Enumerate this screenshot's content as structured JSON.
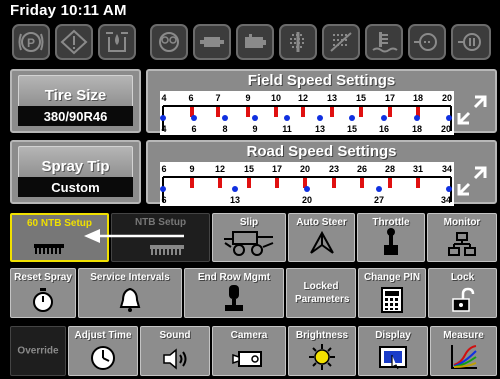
{
  "header": {
    "clock": "Friday 10:11 AM"
  },
  "indicators": [
    {
      "icon": "parking-brake-icon"
    },
    {
      "icon": "warning-icon"
    },
    {
      "icon": "hydraulic-oil-icon"
    },
    {
      "icon": "engine-icon"
    },
    {
      "icon": "transmission-icon"
    },
    {
      "icon": "battery-icon"
    },
    {
      "icon": "filter-icon"
    },
    {
      "icon": "filter-restricted-icon"
    },
    {
      "icon": "coolant-temp-icon"
    },
    {
      "icon": "air-filter-icon"
    },
    {
      "icon": "fuel-filter-icon"
    }
  ],
  "tire_size": {
    "title": "Tire Size",
    "value": "380/90R46"
  },
  "spray_tip": {
    "title": "Spray Tip",
    "value": "Custom"
  },
  "field_speed": {
    "title": "Field Speed Settings",
    "top_labels": [
      "4",
      "6",
      "7",
      "9",
      "10",
      "12",
      "13",
      "15",
      "17",
      "18",
      "20"
    ],
    "bottom_labels": [
      "4",
      "6",
      "8",
      "9",
      "11",
      "13",
      "15",
      "16",
      "18",
      "20"
    ]
  },
  "road_speed": {
    "title": "Road Speed Settings",
    "top_labels": [
      "6",
      "9",
      "12",
      "15",
      "17",
      "20",
      "23",
      "26",
      "28",
      "31",
      "34"
    ],
    "bottom_labels": [
      "6",
      "13",
      "20",
      "27",
      "34"
    ]
  },
  "buttons_row1": [
    {
      "label": "60 NTB Setup",
      "icon": "boom-icon",
      "state": "selected"
    },
    {
      "label": "NTB Setup",
      "icon": "boom-icon",
      "state": "disabled"
    },
    {
      "label": "Slip",
      "icon": "sprayer-vehicle-icon"
    },
    {
      "label": "Auto Steer",
      "icon": "steering-icon"
    },
    {
      "label": "Throttle",
      "icon": "throttle-lever-icon"
    },
    {
      "label": "Monitor",
      "icon": "network-icon"
    }
  ],
  "buttons_row2": [
    {
      "label": "Reset Spray",
      "icon": "stopwatch-icon"
    },
    {
      "label": "Service Intervals",
      "icon": "bell-icon"
    },
    {
      "label": "End Row Mgmt",
      "icon": "joystick-icon"
    },
    {
      "label": "Locked Parameters",
      "icon": ""
    },
    {
      "label": "Change PIN",
      "icon": "keypad-icon"
    },
    {
      "label": "Lock",
      "icon": "padlock-icon"
    }
  ],
  "buttons_row3": [
    {
      "label": "Override",
      "state": "disabled"
    },
    {
      "label": "Adjust Time",
      "icon": "clock-icon"
    },
    {
      "label": "Sound",
      "icon": "speaker-icon"
    },
    {
      "label": "Camera",
      "icon": "camera-icon"
    },
    {
      "label": "Brightness",
      "icon": "sun-icon"
    },
    {
      "label": "Display",
      "icon": "display-touch-icon"
    },
    {
      "label": "Measure",
      "icon": "graph-icon"
    }
  ],
  "colors": {
    "selected_border": "#f0e000",
    "tick_red": "#e01010",
    "tick_blue": "#1030e0"
  }
}
